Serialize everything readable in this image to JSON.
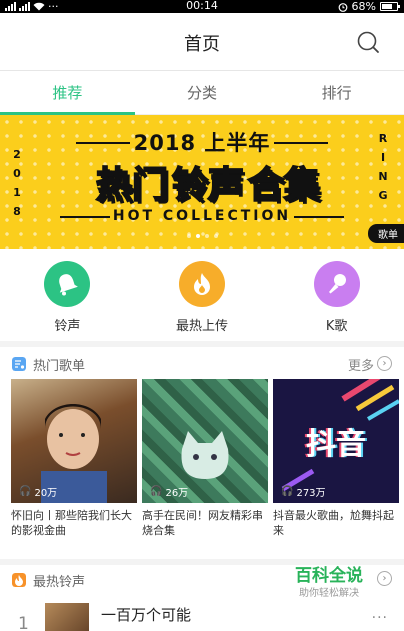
{
  "status_bar": {
    "time": "00:14",
    "battery": "68%",
    "dots": "···"
  },
  "header": {
    "title": "首页"
  },
  "tabs": [
    {
      "label": "推荐"
    },
    {
      "label": "分类"
    },
    {
      "label": "排行"
    }
  ],
  "banner": {
    "year_line": "2018 上半年",
    "side_left": "2 0 1 8",
    "side_right": "R I N G",
    "headline": [
      "热门",
      "铃声",
      "合集"
    ],
    "subtitle": "HOT COLLECTION",
    "tag": "歌单",
    "page_count": 4,
    "active_page": 1
  },
  "quick_actions": [
    {
      "label": "铃声",
      "icon": "bell-icon",
      "color": "#2cc384"
    },
    {
      "label": "最热上传",
      "icon": "flame-icon",
      "color": "#f7ad2a"
    },
    {
      "label": "K歌",
      "icon": "microphone-icon",
      "color": "#c97ef0"
    }
  ],
  "hot_playlists": {
    "title": "热门歌单",
    "more": "更多",
    "items": [
      {
        "plays": "20万",
        "desc": "怀旧向丨那些陪我们长大的影视金曲"
      },
      {
        "plays": "26万",
        "desc": "高手在民间！网友精彩串烧合集"
      },
      {
        "plays": "273万",
        "desc": "抖音最火歌曲，尬舞抖起来"
      }
    ],
    "cover3_text": "抖音"
  },
  "hot_ringtones": {
    "title": "最热铃声",
    "items": [
      {
        "rank": "1",
        "title": "一百万个可能"
      }
    ]
  },
  "watermark": {
    "line1": "百科全说",
    "line2": "助你轻松解决"
  },
  "colors": {
    "accent": "#2cc384",
    "banner": "#fbce1c"
  }
}
